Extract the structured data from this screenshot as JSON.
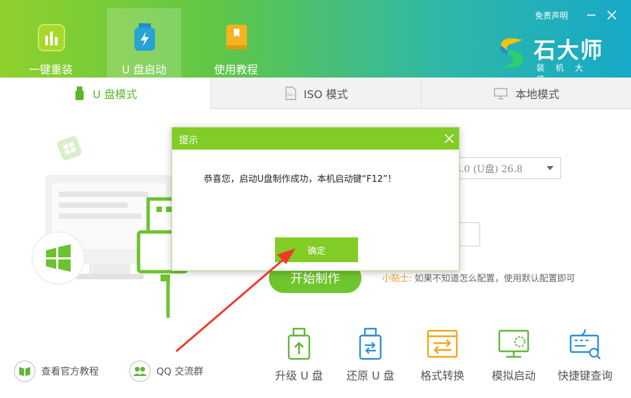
{
  "header": {
    "nav": [
      {
        "label": "一键重装"
      },
      {
        "label": "U 盘启动"
      },
      {
        "label": "使用教程"
      }
    ],
    "disclaimer": "免责声明",
    "brand": {
      "name": "石大师",
      "sub": "装机大师"
    }
  },
  "tabs": [
    {
      "label": "U 盘模式"
    },
    {
      "label": "ISO 模式"
    },
    {
      "label": "本地模式"
    }
  ],
  "main": {
    "device_select": "3.0 (U盘) 26.8",
    "start_button": "开始制作",
    "tip_head": "小贴士:",
    "tip_text": "如果不知道怎么配置，使用默认配置即可"
  },
  "links": [
    {
      "label": "查看官方教程"
    },
    {
      "label": "QQ 交流群"
    }
  ],
  "tools": [
    {
      "label": "升级 U 盘"
    },
    {
      "label": "还原 U 盘"
    },
    {
      "label": "格式转换"
    },
    {
      "label": "模拟启动"
    },
    {
      "label": "快捷键查询"
    }
  ],
  "dialog": {
    "title": "提示",
    "message": "恭喜您，启动U盘制作成功，本机启动键“F12”！",
    "ok": "确定"
  },
  "colors": {
    "accent_green": "#81cc25",
    "arrow_red": "#f03a2a",
    "tip_orange": "#f39a2a"
  }
}
